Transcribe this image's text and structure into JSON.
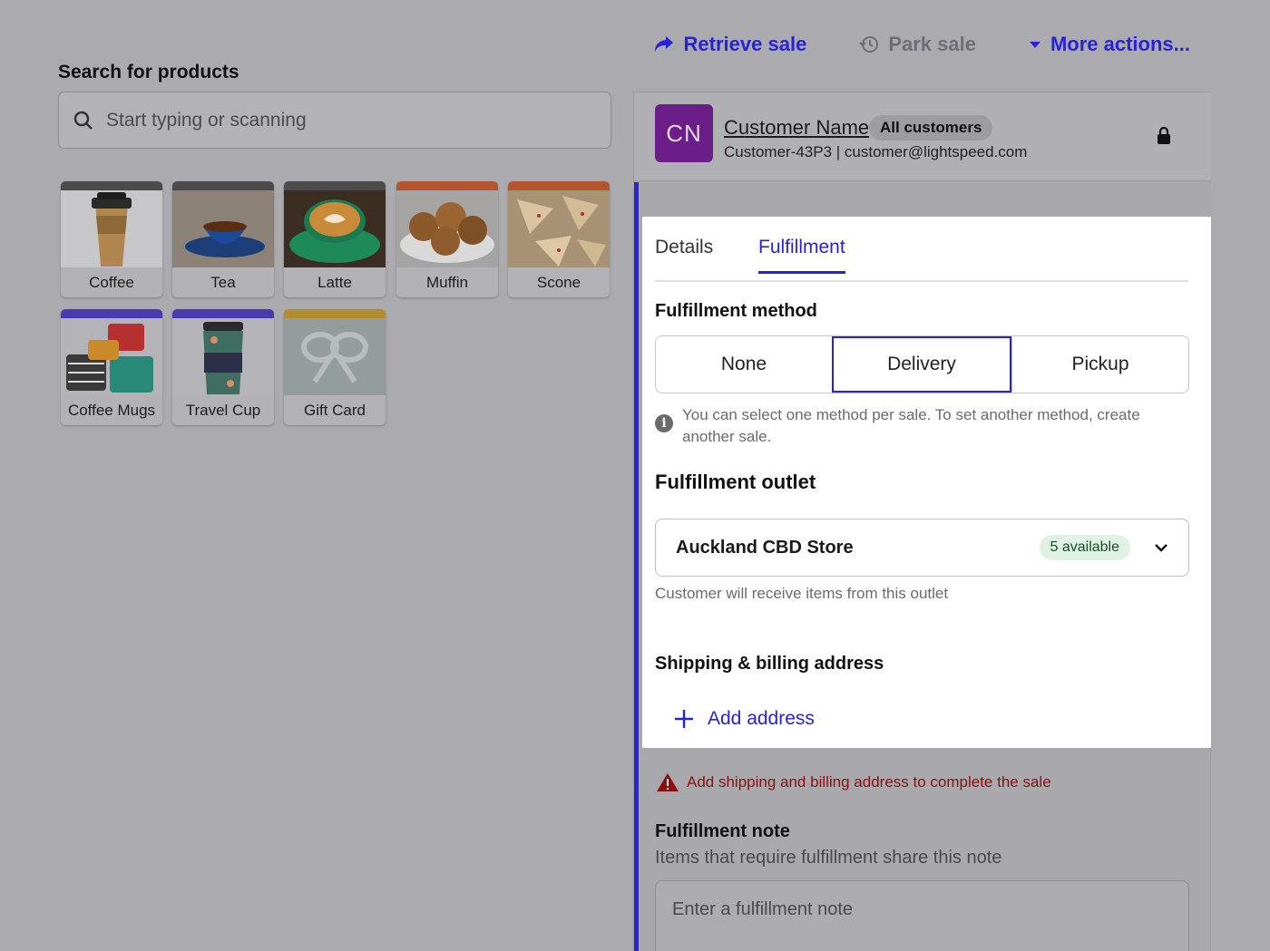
{
  "top_actions": {
    "retrieve_sale": "Retrieve sale",
    "park_sale": "Park sale",
    "more_actions": "More actions..."
  },
  "search": {
    "label": "Search for products",
    "placeholder": "Start typing or scanning"
  },
  "products": [
    {
      "label": "Coffee",
      "stripe": "#4b4b4b",
      "icon": "coffee-cup-icon"
    },
    {
      "label": "Tea",
      "stripe": "#4b4b4b",
      "icon": "tea-cup-icon"
    },
    {
      "label": "Latte",
      "stripe": "#4b4b4b",
      "icon": "latte-icon"
    },
    {
      "label": "Muffin",
      "stripe": "#b5542f",
      "icon": "muffin-icon"
    },
    {
      "label": "Scone",
      "stripe": "#b5542f",
      "icon": "scone-icon"
    },
    {
      "label": "Coffee Mugs",
      "stripe": "#4a3ab0",
      "icon": "mugs-icon"
    },
    {
      "label": "Travel Cup",
      "stripe": "#4a3ab0",
      "icon": "travel-cup-icon"
    },
    {
      "label": "Gift Card",
      "stripe": "#b58a2c",
      "icon": "gift-bow-icon"
    }
  ],
  "customer": {
    "initials": "CN",
    "name": "Customer Name",
    "group": "All customers",
    "details": "Customer-43P3 | customer@lightspeed.com"
  },
  "tabs": [
    {
      "label": "Details",
      "active": false
    },
    {
      "label": "Fulfillment",
      "active": true
    }
  ],
  "fulfillment": {
    "method_title": "Fulfillment method",
    "methods": [
      "None",
      "Delivery",
      "Pickup"
    ],
    "selected_method": "Delivery",
    "method_info": "You can select one method per sale. To set another method, create another sale.",
    "outlet_title": "Fulfillment outlet",
    "outlet_name": "Auckland CBD Store",
    "outlet_availability": "5 available",
    "outlet_hint": "Customer will receive items from this outlet",
    "address_title": "Shipping & billing address",
    "add_address": "Add address",
    "warning": "Add shipping and billing address to complete the sale",
    "note_title": "Fulfillment note",
    "note_subtitle": "Items that require fulfillment share this note",
    "note_placeholder": "Enter a fulfillment note"
  },
  "colors": {
    "accent": "#2a22d6",
    "avatar": "#6b1e87",
    "warning": "#8a1111",
    "available_badge": "#dff2e4"
  }
}
